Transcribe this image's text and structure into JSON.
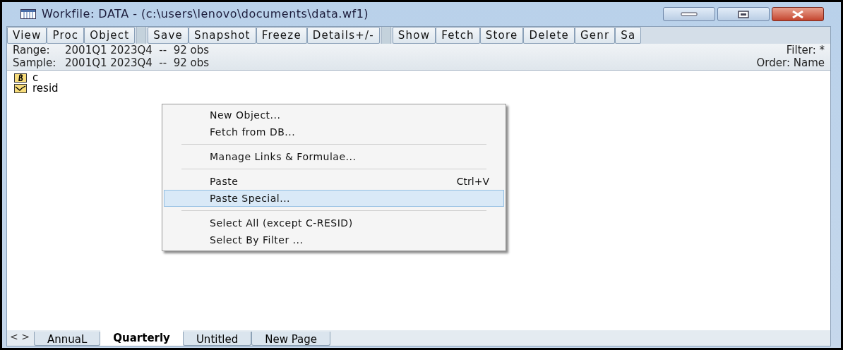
{
  "window": {
    "title": "Workfile: DATA - (c:\\users\\lenovo\\documents\\data.wf1)"
  },
  "toolbar": [
    {
      "label": "View",
      "kind": "button"
    },
    {
      "label": "Proc",
      "kind": "button"
    },
    {
      "label": "Object",
      "kind": "button"
    },
    {
      "kind": "gap"
    },
    {
      "label": "Save",
      "kind": "button"
    },
    {
      "label": "Snapshot",
      "kind": "button"
    },
    {
      "label": "Freeze",
      "kind": "button"
    },
    {
      "label": "Details+/-",
      "kind": "button"
    },
    {
      "kind": "gap"
    },
    {
      "label": "Show",
      "kind": "button"
    },
    {
      "label": "Fetch",
      "kind": "button"
    },
    {
      "label": "Store",
      "kind": "button"
    },
    {
      "label": "Delete",
      "kind": "button"
    },
    {
      "label": "Genr",
      "kind": "button"
    },
    {
      "label": "Sa",
      "kind": "button"
    }
  ],
  "info": {
    "range_label": "Range:",
    "range": "2001Q1 2023Q4  --  92 obs",
    "sample_label": "Sample:",
    "sample": "2001Q1 2023Q4  --  92 obs",
    "filter": "Filter: *",
    "order": "Order: Name"
  },
  "objects": [
    {
      "name": "c",
      "kind": "coef"
    },
    {
      "name": "resid",
      "kind": "series"
    }
  ],
  "context_menu": [
    {
      "kind": "item",
      "label": "New Object...",
      "selected": false
    },
    {
      "kind": "item",
      "label": "Fetch from DB...",
      "selected": false
    },
    {
      "kind": "separator"
    },
    {
      "kind": "item",
      "label": "Manage Links & Formulae...",
      "selected": false
    },
    {
      "kind": "separator"
    },
    {
      "kind": "item",
      "label": "Paste",
      "shortcut": "Ctrl+V",
      "selected": false
    },
    {
      "kind": "item",
      "label": "Paste Special...",
      "selected": true
    },
    {
      "kind": "separator"
    },
    {
      "kind": "item",
      "label": "Select All (except C-RESID)",
      "selected": false
    },
    {
      "kind": "item",
      "label": "Select By Filter ...",
      "selected": false
    }
  ],
  "page_tabs": {
    "nav": "< >",
    "tabs": [
      {
        "label": "AnnuaL",
        "selected": false
      },
      {
        "label": "Quarterly",
        "selected": true
      },
      {
        "label": "Untitled",
        "selected": false
      },
      {
        "label": "New Page",
        "selected": false
      }
    ]
  }
}
